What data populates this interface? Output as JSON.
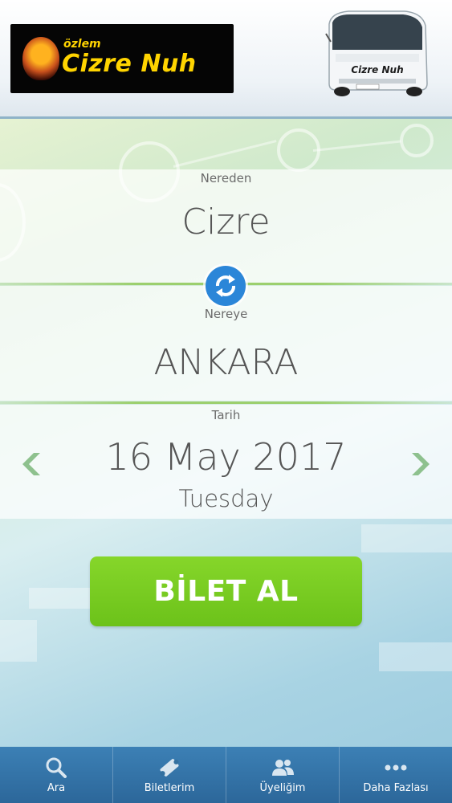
{
  "header": {
    "brand_small": "özlem",
    "brand": "Cizre Nuh",
    "bus_text": "Cizre Nuh"
  },
  "search": {
    "from_label": "Nereden",
    "from_value": "Cizre",
    "to_label": "Nereye",
    "to_value": "ANKARA",
    "date_label": "Tarih",
    "date_value": "16 May 2017",
    "day_value": "Tuesday",
    "prev_icon": "chevron-left-icon",
    "next_icon": "chevron-right-icon",
    "swap_icon": "swap-icon"
  },
  "buy_button": "BİLET AL",
  "nav": {
    "items": [
      {
        "label": "Ara",
        "icon": "search-icon"
      },
      {
        "label": "Biletlerim",
        "icon": "ticket-icon"
      },
      {
        "label": "Üyeliğim",
        "icon": "users-icon"
      },
      {
        "label": "Daha Fazlası",
        "icon": "more-icon"
      }
    ]
  },
  "colors": {
    "accent_green": "#72c61f",
    "nav_blue": "#2f6fa2",
    "swap_blue": "#2b86d8"
  }
}
